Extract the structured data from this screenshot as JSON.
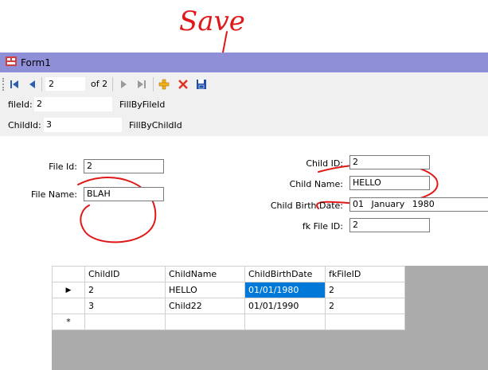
{
  "annotation": {
    "save_note": "Save"
  },
  "window": {
    "title": "Form1"
  },
  "navigator": {
    "position": "2",
    "count_label": "of 2"
  },
  "fill_by_file": {
    "label": "fileId:",
    "value": "2",
    "button": "FillByFileId"
  },
  "fill_by_child": {
    "label": "ChildId:",
    "value": "3",
    "button": "FillByChildId"
  },
  "file_form": {
    "file_id_label": "File Id:",
    "file_id_value": "2",
    "file_name_label": "File Name:",
    "file_name_value": "BLAH"
  },
  "child_form": {
    "child_id_label": "Child ID:",
    "child_id_value": "2",
    "child_name_label": "Child Name:",
    "child_name_value": "HELLO",
    "birth_label": "Child Birth Date:",
    "birth_day": "01",
    "birth_month": "January",
    "birth_year": "1980",
    "fk_label": "fk File ID:",
    "fk_value": "2"
  },
  "grid": {
    "columns": [
      "ChildID",
      "ChildName",
      "ChildBirthDate",
      "fkFileID"
    ],
    "rows": [
      [
        "2",
        "HELLO",
        "01/01/1980",
        "2"
      ],
      [
        "3",
        "Child22",
        "01/01/1990",
        "2"
      ]
    ],
    "current_row_glyph": "▶",
    "new_row_glyph": "*"
  },
  "colors": {
    "annotation_red": "#e01818",
    "titlebar": "#8f8fd8",
    "selection": "#0078d7"
  }
}
